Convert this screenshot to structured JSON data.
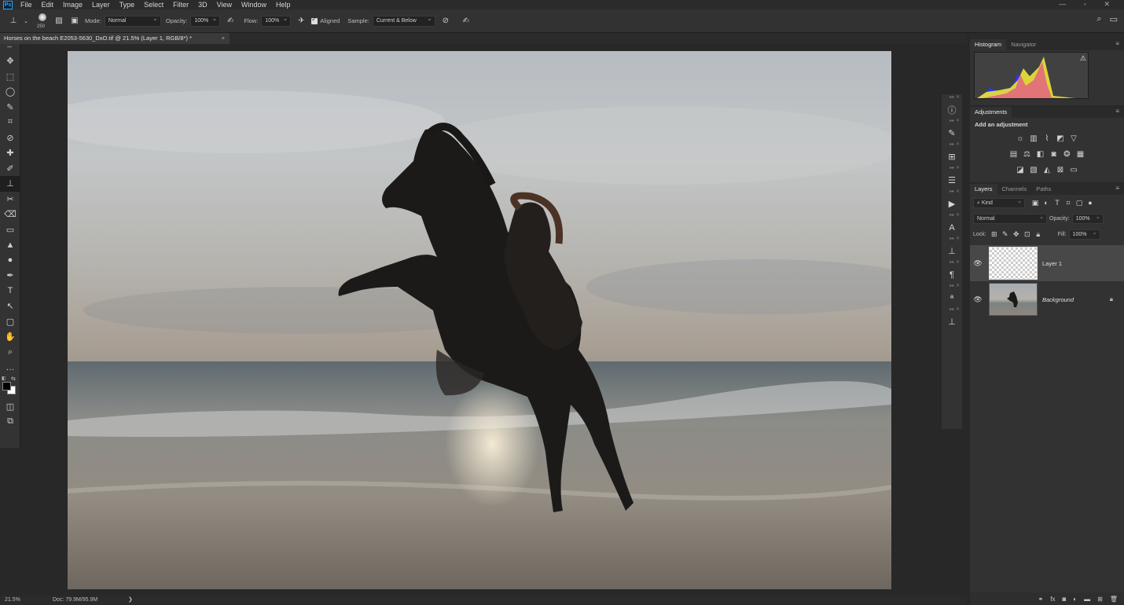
{
  "app": {
    "logo": "Ps",
    "window_controls": "— ▫ ✕"
  },
  "menu": [
    "File",
    "Edit",
    "Image",
    "Layer",
    "Type",
    "Select",
    "Filter",
    "3D",
    "View",
    "Window",
    "Help"
  ],
  "options": {
    "brush_size": "250",
    "mode_label": "Mode:",
    "mode_value": "Normal",
    "opacity_label": "Opacity:",
    "opacity_value": "100%",
    "flow_label": "Flow:",
    "flow_value": "100%",
    "aligned_label": "Aligned",
    "sample_label": "Sample:",
    "sample_value": "Current & Below"
  },
  "document": {
    "tab_title": "Horses on the beach E2053-5630_DxO.tif @ 21.5% (Layer 1, RGB/8*) *",
    "close": "×"
  },
  "tools": [
    "✥",
    "⬚",
    "◯",
    "✎",
    "⌗",
    "⊘",
    "✚",
    "✐",
    "⊥",
    "✂",
    "⌫",
    "▭",
    "▲",
    "●",
    "✒",
    "T",
    "↖",
    "▢",
    "✋",
    "⌕",
    "…"
  ],
  "histogram": {
    "tab_active": "Histogram",
    "tab_other": "Navigator",
    "warning": "⚠"
  },
  "adjustments": {
    "tab": "Adjustments",
    "subtitle": "Add an adjustment"
  },
  "layers": {
    "tabs": [
      "Layers",
      "Channels",
      "Paths"
    ],
    "kind_label": "Kind",
    "blend_mode": "Normal",
    "opacity_label": "Opacity:",
    "opacity_value": "100%",
    "lock_label": "Lock:",
    "fill_label": "Fill:",
    "fill_value": "100%",
    "items": [
      {
        "name": "Layer 1",
        "selected": true
      },
      {
        "name": "Background",
        "locked": true
      }
    ]
  },
  "status": {
    "zoom": "21.5%",
    "doc": "Doc: 79.9M/95.9M",
    "arrow": "❯"
  },
  "colors": {
    "accent": "#31a8ff",
    "panel": "#323232",
    "bg": "#282828"
  }
}
